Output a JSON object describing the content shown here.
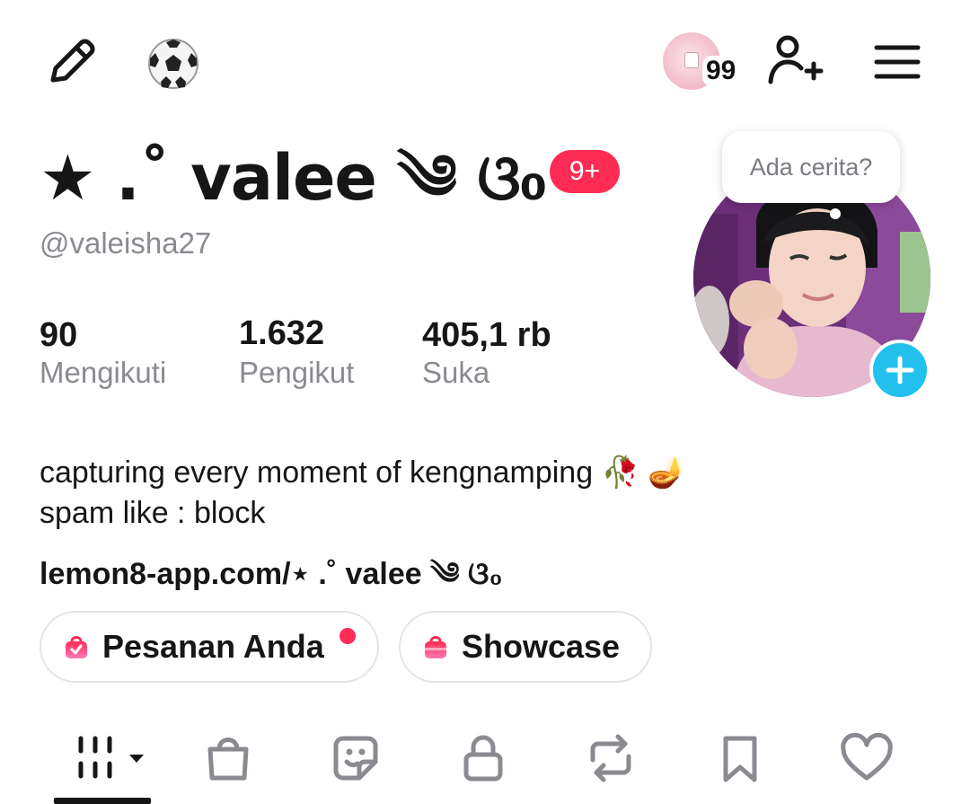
{
  "header": {
    "notification_count": "99"
  },
  "profile": {
    "display_name": "★ .˚ valee ༄ ଓ₀",
    "name_badge": "9+",
    "username": "@valeisha27",
    "story_prompt": "Ada cerita?"
  },
  "stats": [
    {
      "value": "90",
      "label": "Mengikuti"
    },
    {
      "value": "1.632",
      "label": "Pengikut"
    },
    {
      "value": "405,1 rb",
      "label": "Suka"
    }
  ],
  "bio": {
    "line1": "capturing every moment of kengnamping 🥀 🪔",
    "line2": "spam like : block",
    "link": "lemon8-app.com/⋆ .˚ valee ༄ ଓ₀"
  },
  "actions": {
    "orders_label": "Pesanan Anda",
    "showcase_label": "Showcase"
  },
  "tabs": [
    {
      "icon": "grid-icon",
      "selected": true
    },
    {
      "icon": "shopping-bag-icon"
    },
    {
      "icon": "sticker-icon"
    },
    {
      "icon": "lock-icon"
    },
    {
      "icon": "repost-icon"
    },
    {
      "icon": "bookmark-icon"
    },
    {
      "icon": "heart-icon"
    }
  ],
  "colors": {
    "accent_red": "#fe2c55",
    "story_add_blue": "#23c0ed",
    "secondary_text": "#8a8b91"
  }
}
